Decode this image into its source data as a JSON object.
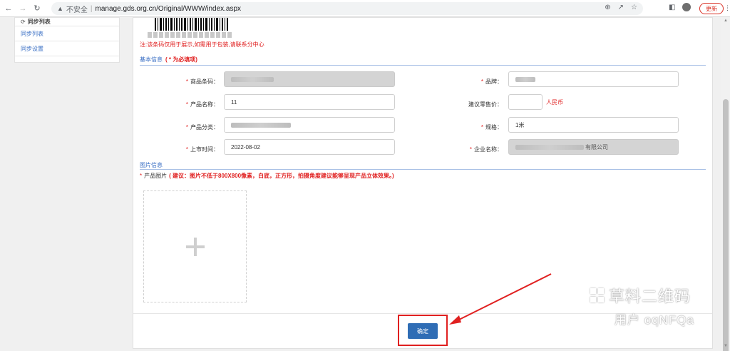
{
  "browser": {
    "back_icon": "arrow-left-icon",
    "forward_icon": "arrow-right-icon",
    "reload_icon": "reload-icon",
    "security_label": "不安全",
    "url": "manage.gds.org.cn/Original/WWW/index.aspx",
    "update_label": "更新"
  },
  "sidebar": {
    "header": "同步列表",
    "items": [
      {
        "label": "同步列表"
      },
      {
        "label": "同步设置"
      }
    ]
  },
  "barcode": {
    "notice": "注:该条码仅用于展示,如需用于包装,请联系分中心"
  },
  "basic_info": {
    "title": "基本信息",
    "required_hint": "( * 为必填项)"
  },
  "form": {
    "product_barcode": {
      "label": "商品条码：",
      "value": ""
    },
    "brand": {
      "label": "品牌：",
      "value": ""
    },
    "product_name": {
      "label": "产品名称：",
      "value": "11"
    },
    "retail_price": {
      "label": "建议零售价：",
      "value": "",
      "unit": "人民币"
    },
    "category": {
      "label": "产品分类：",
      "value": ""
    },
    "spec": {
      "label": "规格：",
      "value": "1米"
    },
    "launch_date": {
      "label": "上市时间：",
      "value": "2022-08-02"
    },
    "company": {
      "label": "企业名称：",
      "value": "有限公司"
    }
  },
  "image_info": {
    "title": "图片信息",
    "label": "产品图片",
    "tip": "( 建议：图片不低于800X800像素，白底，正方形，拍摄角度建议能够呈现产品立体效果。)"
  },
  "actions": {
    "confirm_label": "确定"
  },
  "watermark": {
    "brand": "草料二维码",
    "user": "用户 oqNFQa"
  },
  "colors": {
    "accent": "#2f6db5",
    "required": "#e02020",
    "link": "#3a6fc4"
  }
}
